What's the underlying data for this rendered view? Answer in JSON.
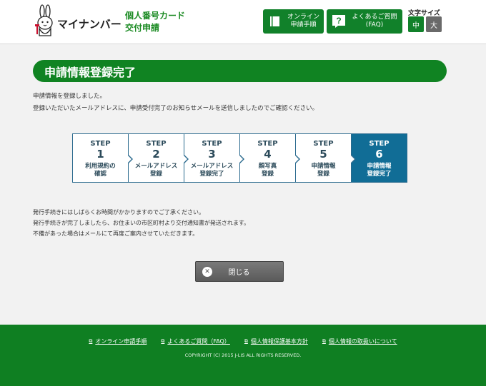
{
  "header": {
    "logo_text": "マイナンバー",
    "site_title_line1": "個人番号カード",
    "site_title_line2": "交付申請",
    "online_label_1": "オンライン",
    "online_label_2": "申請手順",
    "faq_label_1": "よくあるご質問",
    "faq_label_2": "(FAQ)",
    "fontsize_label": "文字サイズ",
    "fontsize_mid": "中",
    "fontsize_big": "大"
  },
  "main": {
    "title": "申請情報登録完了",
    "message1": "申請情報を登録しました。",
    "message2": "登録いただいたメールアドレスに、申請受付完了のお知らせメールを送信しましたのでご確認ください。",
    "steps": [
      {
        "word": "STEP",
        "num": "1",
        "line1": "利用規約の",
        "line2": "確認"
      },
      {
        "word": "STEP",
        "num": "2",
        "line1": "メールアドレス",
        "line2": "登録"
      },
      {
        "word": "STEP",
        "num": "3",
        "line1": "メールアドレス",
        "line2": "登録完了"
      },
      {
        "word": "STEP",
        "num": "4",
        "line1": "顔写真",
        "line2": "登録"
      },
      {
        "word": "STEP",
        "num": "5",
        "line1": "申請情報",
        "line2": "登録"
      },
      {
        "word": "STEP",
        "num": "6",
        "line1": "申請情報",
        "line2": "登録完了"
      }
    ],
    "active_step": 6,
    "note1": "発行手続きにはしばらくお時間がかかりますのでご了承ください。",
    "note2": "発行手続きが完了しましたら、お住まいの市区町村より交付通知書が発送されます。",
    "note3": "不備があった場合はメールにて再度ご案内させていただきます。",
    "close_label": "閉じる"
  },
  "footer": {
    "links": [
      "オンライン申請手順",
      "よくあるご質問（FAQ）",
      "個人情報保護基本方針",
      "個人情報の取扱いについて"
    ],
    "copyright": "COPYRIGHT (C) 2015 J-LIS ALL RIGHTS RESERVED."
  },
  "colors": {
    "brand_green": "#11812a",
    "step_active": "#116d96",
    "close_button": "#666666"
  },
  "icons": [
    "rabbit-mascot-icon",
    "book-icon",
    "question-icon",
    "close-circle-icon",
    "external-link-icon"
  ]
}
